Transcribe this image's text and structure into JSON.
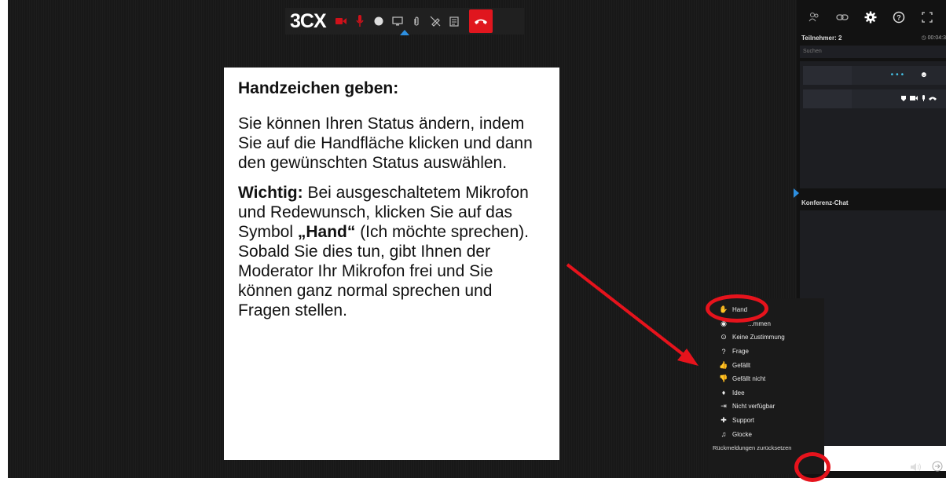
{
  "toolbar": {
    "logo": "3CX",
    "buttons": [
      "camera-icon",
      "microphone-icon",
      "record-icon",
      "screen-share-icon",
      "attach-icon",
      "pen-off-icon",
      "whiteboard-icon"
    ],
    "hangup": "hangup-icon"
  },
  "callout": {
    "heading": "Handzeichen geben:",
    "para1": "Sie können Ihren Status ändern, indem Sie auf die Handfläche klicken und dann den gewünschten Status auswählen.",
    "para2_bold": "Wichtig:",
    "para2_a": " Bei ausgeschaltetem Mikrofon und Redewunsch, klicken Sie auf das Symbol ",
    "para2_hand": "„Hand“",
    "para2_b": " (Ich möchte sprechen). Sobald Sie dies tun, gibt Ihnen der Moderator Ihr Mikrofon frei und Sie können ganz normal sprechen und Fragen stellen."
  },
  "panel": {
    "participants_label": "Teilnehmer: 2",
    "timer": "00:04:3",
    "search_placeholder": "Suchen",
    "chat_label": "Konferenz-Chat"
  },
  "menu": {
    "items": [
      {
        "icon": "hand-icon",
        "label": "Hand"
      },
      {
        "icon": "agree-icon",
        "label": "...mmen"
      },
      {
        "icon": "no-agree-icon",
        "label": "Keine Zustimmung"
      },
      {
        "icon": "question-icon",
        "label": "Frage"
      },
      {
        "icon": "thumbs-up-icon",
        "label": "Gefällt"
      },
      {
        "icon": "thumbs-down-icon",
        "label": "Gefällt nicht"
      },
      {
        "icon": "bulb-icon",
        "label": "Idee"
      },
      {
        "icon": "away-icon",
        "label": "Nicht verfügbar"
      },
      {
        "icon": "support-icon",
        "label": "Support"
      },
      {
        "icon": "bell-icon",
        "label": "Glocke"
      }
    ],
    "reset_label": "Rückmeldungen zurücksetzen"
  },
  "colors": {
    "accent": "#2d8fe0",
    "alert": "#e6131c",
    "hangup": "#e0161e"
  }
}
